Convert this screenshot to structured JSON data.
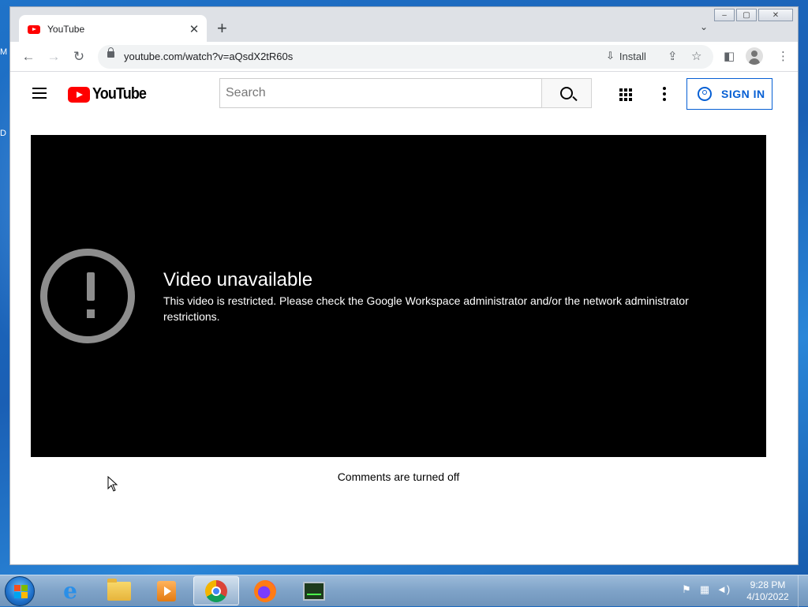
{
  "desktop": {
    "letters": [
      "M",
      "D"
    ]
  },
  "browser": {
    "tab": {
      "title": "YouTube",
      "close": "✕"
    },
    "new_tab": "+",
    "tab_menu": "⌄",
    "window_controls": {
      "minimize": "–",
      "maximize": "▢",
      "close": "✕"
    },
    "nav": {
      "back": "←",
      "forward": "→",
      "reload": "↻"
    },
    "url": "youtube.com/watch?v=aQsdX2tR60s",
    "install_label": "Install",
    "icons": [
      "install-icon",
      "share-icon",
      "star-icon",
      "side-panel-icon",
      "profile-icon",
      "menu-icon"
    ]
  },
  "youtube": {
    "logo_text": "YouTube",
    "search_placeholder": "Search",
    "search_value": "",
    "sign_in_label": "SIGN IN",
    "error": {
      "title": "Video unavailable",
      "message": "This video is restricted. Please check the Google Workspace administrator and/or the network administrator restrictions."
    },
    "comments_status": "Comments are turned off"
  },
  "taskbar": {
    "apps": [
      "internet-explorer",
      "file-explorer",
      "media-player",
      "chrome",
      "firefox",
      "task-manager"
    ],
    "active_app": "chrome",
    "clock": {
      "time": "9:28 PM",
      "date": "4/10/2022"
    }
  },
  "colors": {
    "youtube_red": "#ff0000",
    "sign_in_blue": "#065fd4",
    "player_bg": "#000000"
  }
}
